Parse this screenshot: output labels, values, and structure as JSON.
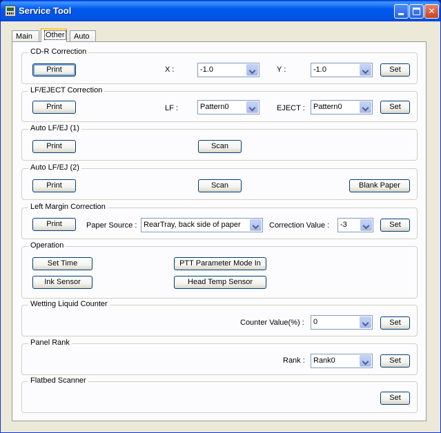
{
  "window": {
    "title": "Service Tool"
  },
  "tabs": [
    {
      "label": "Main"
    },
    {
      "label": "Other"
    },
    {
      "label": "Auto"
    }
  ],
  "cdr": {
    "title": "CD-R Correction",
    "print": "Print",
    "x_label": "X :",
    "x_value": "-1.0",
    "y_label": "Y :",
    "y_value": "-1.0",
    "set": "Set"
  },
  "lfeject": {
    "title": "LF/EJECT Correction",
    "print": "Print",
    "lf_label": "LF :",
    "lf_value": "Pattern0",
    "eject_label": "EJECT :",
    "eject_value": "Pattern0",
    "set": "Set"
  },
  "autolf1": {
    "title": "Auto LF/EJ (1)",
    "print": "Print",
    "scan": "Scan"
  },
  "autolf2": {
    "title": "Auto LF/EJ (2)",
    "print": "Print",
    "scan": "Scan",
    "blank": "Blank Paper"
  },
  "leftmargin": {
    "title": "Left Margin Correction",
    "print": "Print",
    "source_label": "Paper Source :",
    "source_value": "RearTray, back side of paper",
    "corr_label": "Correction Value :",
    "corr_value": "-3",
    "set": "Set"
  },
  "operation": {
    "title": "Operation",
    "set_time": "Set Time",
    "ink_sensor": "Ink Sensor",
    "ptt": "PTT Parameter Mode In",
    "head_temp": "Head Temp Sensor"
  },
  "wetting": {
    "title": "Wetting Liquid Counter",
    "label": "Counter Value(%) :",
    "value": "0",
    "set": "Set"
  },
  "panelrank": {
    "title": "Panel Rank",
    "label": "Rank :",
    "value": "Rank0",
    "set": "Set"
  },
  "flatbed": {
    "title": "Flatbed Scanner",
    "set": "Set"
  }
}
